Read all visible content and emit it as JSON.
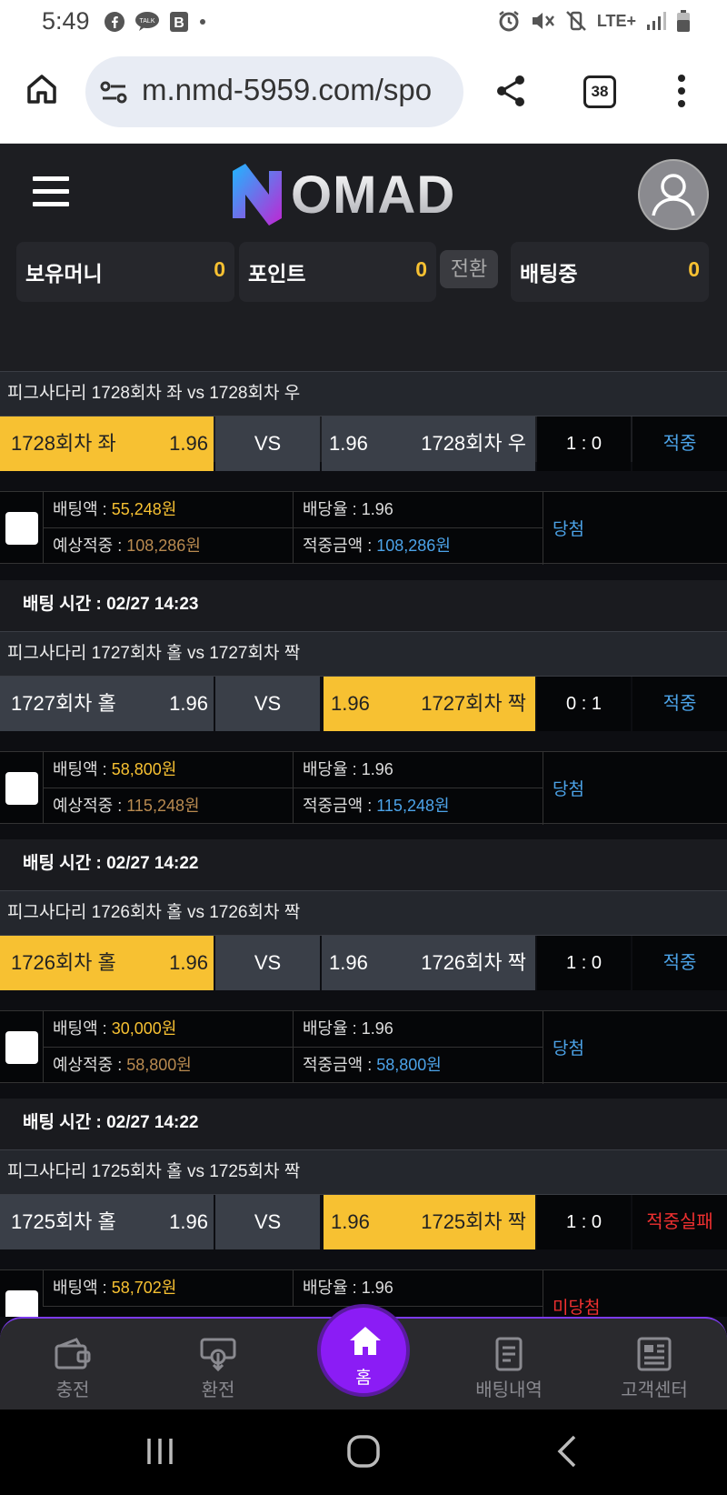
{
  "status_bar": {
    "time": "5:49",
    "network": "LTE+"
  },
  "browser": {
    "url": "m.nmd-5959.com/spo",
    "tab_count": "38"
  },
  "site": {
    "logo": "NOMAD",
    "balances": [
      {
        "label": "보유머니",
        "value": "0"
      },
      {
        "label": "포인트",
        "value": "0"
      },
      {
        "label": "배팅중",
        "value": "0"
      }
    ],
    "convert_label": "전환"
  },
  "bets": [
    {
      "title": "피그사다리 1728회차 좌  vs  1728회차 우",
      "home": "1728회차 좌",
      "home_odds": "1.96",
      "vs": "VS",
      "away_odds": "1.96",
      "away": "1728회차 우",
      "score": "1 : 0",
      "result": "적중",
      "bet_amount_label": "배팅액 : ",
      "bet_amount": "55,248원",
      "odds_label": "배당율 : ",
      "odds": "1.96",
      "expected_label": "예상적중 : ",
      "expected": "108,286원",
      "win_amount_label": "적중금액 : ",
      "win_amount": "108,286원",
      "status": "당첨"
    },
    {
      "time": "배팅 시간 : 02/27 14:23",
      "title": "피그사다리 1727회차 홀  vs  1727회차 짝",
      "home": "1727회차 홀",
      "home_odds": "1.96",
      "vs": "VS",
      "away_odds": "1.96",
      "away": "1727회차 짝",
      "score": "0 : 1",
      "result": "적중",
      "bet_amount_label": "배팅액 : ",
      "bet_amount": "58,800원",
      "odds_label": "배당율 : ",
      "odds": "1.96",
      "expected_label": "예상적중 : ",
      "expected": "115,248원",
      "win_amount_label": "적중금액 : ",
      "win_amount": "115,248원",
      "status": "당첨"
    },
    {
      "time": "배팅 시간 : 02/27 14:22",
      "title": "피그사다리 1726회차 홀  vs  1726회차 짝",
      "home": "1726회차 홀",
      "home_odds": "1.96",
      "vs": "VS",
      "away_odds": "1.96",
      "away": "1726회차 짝",
      "score": "1 : 0",
      "result": "적중",
      "bet_amount_label": "배팅액 : ",
      "bet_amount": "30,000원",
      "odds_label": "배당율 : ",
      "odds": "1.96",
      "expected_label": "예상적중 : ",
      "expected": "58,800원",
      "win_amount_label": "적중금액 : ",
      "win_amount": "58,800원",
      "status": "당첨"
    },
    {
      "time": "배팅 시간 : 02/27 14:22",
      "title": "피그사다리 1725회차 홀  vs  1725회차 짝",
      "home": "1725회차 홀",
      "home_odds": "1.96",
      "vs": "VS",
      "away_odds": "1.96",
      "away": "1725회차 짝",
      "score": "1 : 0",
      "result": "적중실패",
      "bet_amount_label": "배팅액 : ",
      "bet_amount": "58,702원",
      "odds_label": "배당율 : ",
      "odds": "1.96",
      "status": "미당첨"
    }
  ],
  "bottom_nav": {
    "deposit": "충전",
    "withdraw": "환전",
    "home": "홈",
    "bet_history": "배팅내역",
    "support": "고객센터"
  },
  "colors": {
    "accent": "#f7c132",
    "win": "#4ca3e8",
    "fail": "#f03030",
    "home_button": "#8b1cf5"
  }
}
